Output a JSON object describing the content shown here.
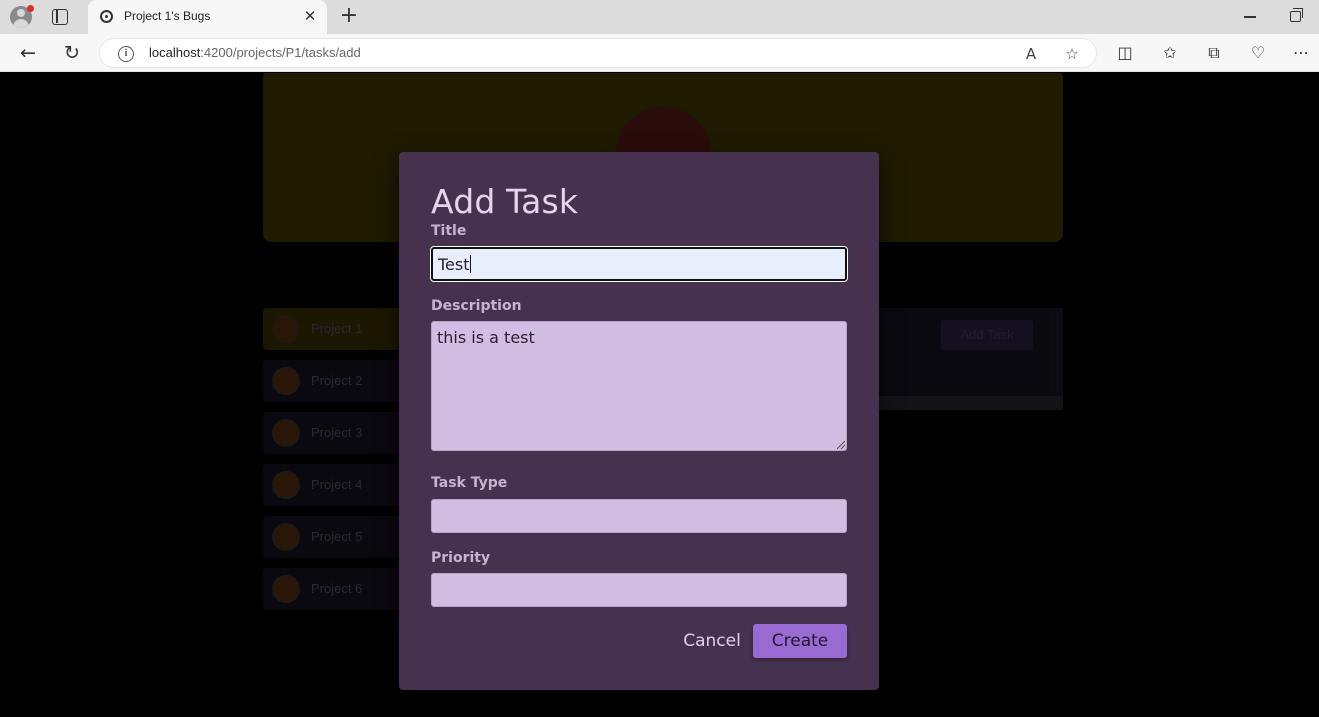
{
  "browser": {
    "tab_title": "Project 1's Bugs",
    "url_host": "localhost",
    "url_path": ":4200/projects/P1/tasks/add"
  },
  "page": {
    "projects": [
      "Project 1",
      "Project 2",
      "Project 3",
      "Project 4",
      "Project 5",
      "Project 6"
    ],
    "add_task_label": "Add Task"
  },
  "modal": {
    "title": "Add Task",
    "title_label": "Title",
    "title_value": "Test",
    "description_label": "Description",
    "description_value": "this is a test",
    "task_type_label": "Task Type",
    "task_type_value": "",
    "priority_label": "Priority",
    "priority_value": "",
    "cancel_label": "Cancel",
    "create_label": "Create"
  }
}
